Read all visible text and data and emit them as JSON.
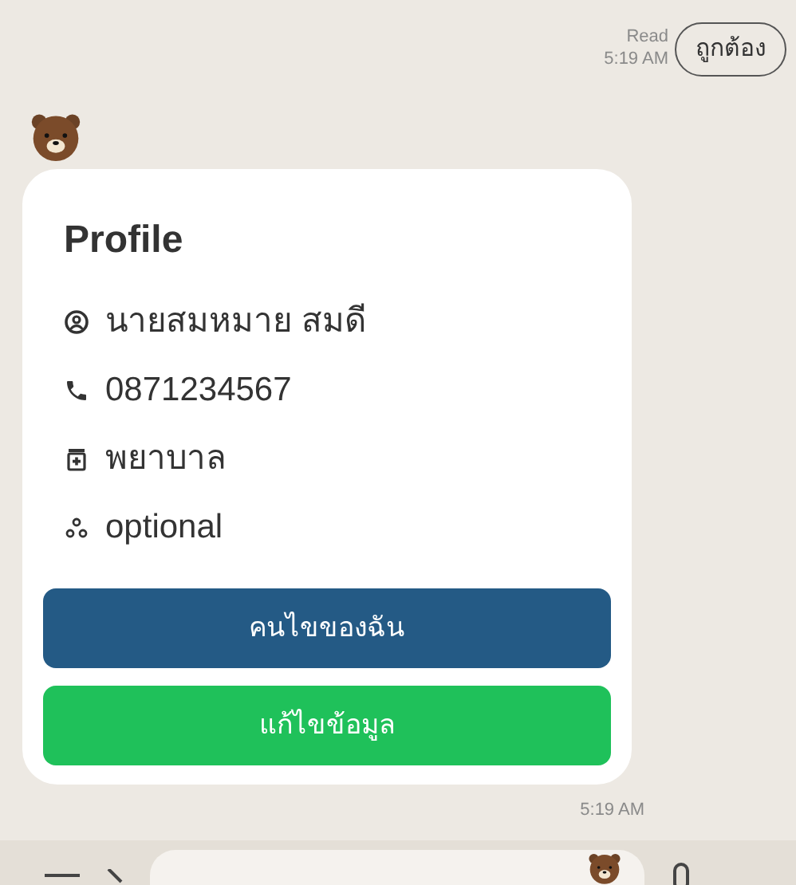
{
  "sent_message": {
    "read_label": "Read",
    "time": "5:19 AM",
    "text": "ถูกต้อง"
  },
  "received_message": {
    "card": {
      "title": "Profile",
      "rows": [
        {
          "kind": "person",
          "text": "นายสมหมาย สมดี"
        },
        {
          "kind": "phone",
          "text": "0871234567"
        },
        {
          "kind": "medical",
          "text": "พยาบาล"
        },
        {
          "kind": "network",
          "text": "optional"
        }
      ],
      "buttons": [
        {
          "kind": "primary",
          "label": "คนไขของฉัน"
        },
        {
          "kind": "success",
          "label": "แก้ไขข้อมูล"
        }
      ]
    },
    "time": "5:19 AM"
  }
}
